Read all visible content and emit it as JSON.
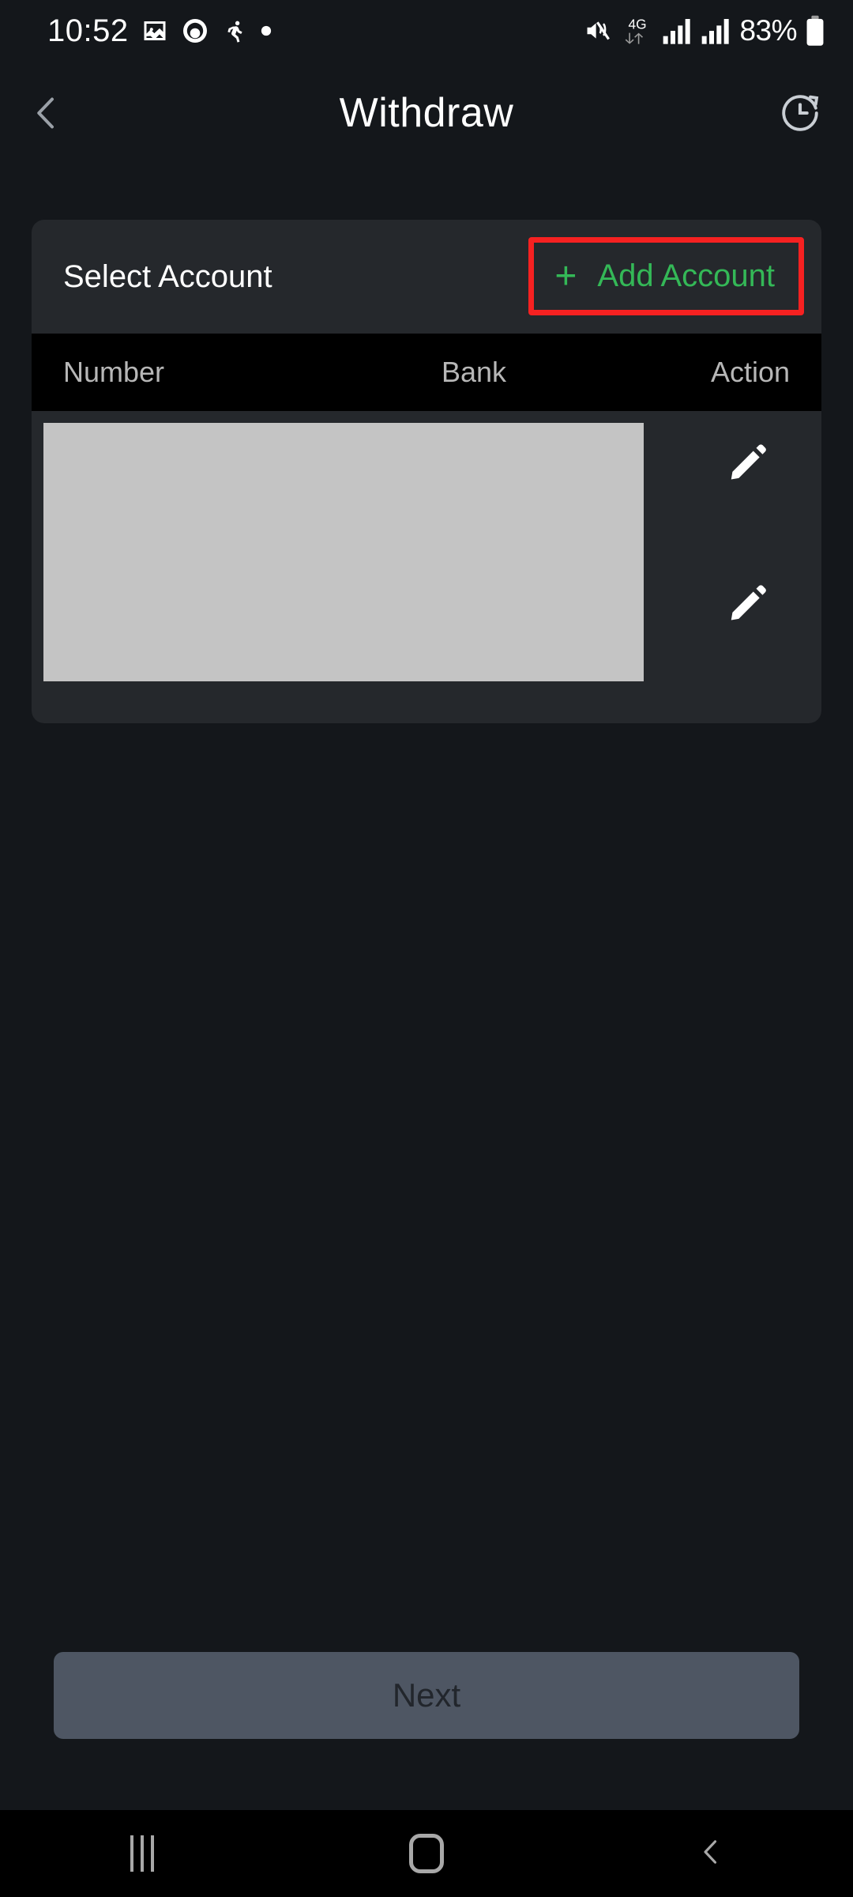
{
  "status_bar": {
    "time": "10:52",
    "left_icons": [
      "image-icon",
      "circle-record-icon",
      "person-icon",
      "dot-icon"
    ],
    "network_type": "4G",
    "battery_percent": "83%",
    "right_icons": [
      "mute-icon",
      "data-transfer-icon",
      "signal-bars-icon",
      "signal-bars-2-icon",
      "battery-icon"
    ]
  },
  "header": {
    "back_icon": "chevron-left-icon",
    "title": "Withdraw",
    "history_icon": "history-clock-icon"
  },
  "account_card": {
    "section_label": "Select Account",
    "add_account": {
      "plus": "+",
      "label": "Add Account",
      "accent_color": "#34b857",
      "highlight_color": "#f62121"
    },
    "table": {
      "columns": [
        "Number",
        "Bank",
        "Action"
      ],
      "rows": [
        {
          "number": "",
          "bank": "",
          "action_icon": "pencil-edit-icon"
        },
        {
          "number": "",
          "bank": "",
          "action_icon": "pencil-edit-icon"
        }
      ],
      "redacted_block_color": "#c4c4c4"
    }
  },
  "footer": {
    "next_label": "Next",
    "next_enabled": false,
    "next_bg_color": "#4e5663",
    "next_text_color": "#22262c"
  },
  "nav_bar": {
    "recents_icon": "recents-bars-icon",
    "home_icon": "home-square-icon",
    "back_icon": "nav-back-chevron-icon"
  },
  "theme": {
    "background": "#14171b",
    "card_background": "#25282c",
    "table_header_background": "#000000",
    "primary_text": "#ffffff",
    "muted_text": "#b7b7b7"
  }
}
